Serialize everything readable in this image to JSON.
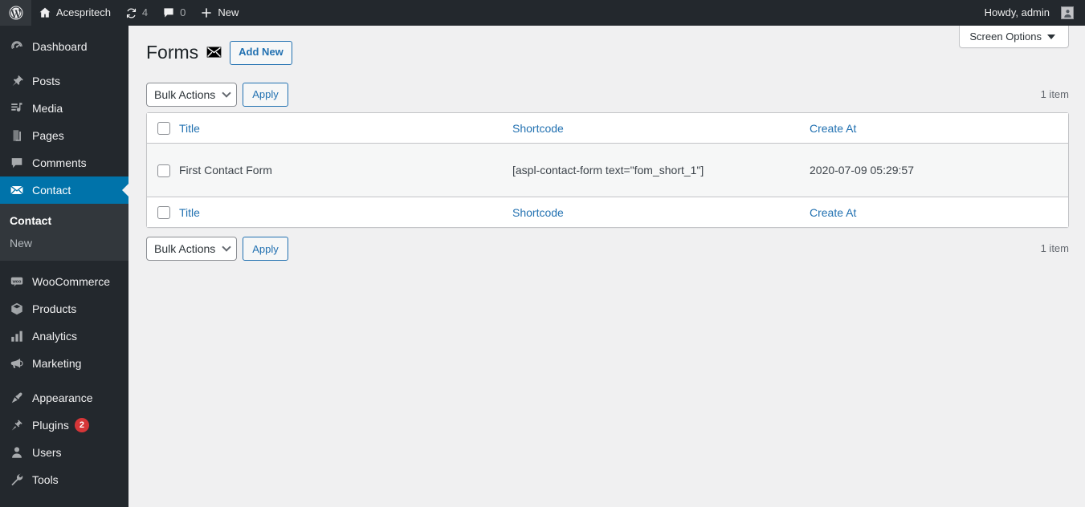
{
  "adminbar": {
    "logo_icon": "wordpress-logo-icon",
    "site_name": "Acespritech",
    "site_icon": "home-icon",
    "updates_icon": "updates-icon",
    "updates_count": "4",
    "comments_icon": "comment-bubble-icon",
    "comments_count": "0",
    "new_icon": "plus-icon",
    "new_label": "New",
    "howdy": "Howdy, admin",
    "avatar_icon": "user-avatar-icon"
  },
  "sidebar": {
    "items": [
      {
        "label": "Dashboard",
        "icon": "dashboard-icon",
        "slug": "dashboard"
      },
      {
        "label": "Posts",
        "icon": "pin-icon",
        "slug": "posts"
      },
      {
        "label": "Media",
        "icon": "media-icon",
        "slug": "media"
      },
      {
        "label": "Pages",
        "icon": "pages-icon",
        "slug": "pages"
      },
      {
        "label": "Comments",
        "icon": "comment-bubble-icon",
        "slug": "comments"
      },
      {
        "label": "Contact",
        "icon": "envelope-icon",
        "slug": "contact",
        "current": true
      },
      {
        "label": "WooCommerce",
        "icon": "woocommerce-icon",
        "slug": "woocommerce"
      },
      {
        "label": "Products",
        "icon": "box-icon",
        "slug": "products"
      },
      {
        "label": "Analytics",
        "icon": "bar-chart-icon",
        "slug": "analytics"
      },
      {
        "label": "Marketing",
        "icon": "megaphone-icon",
        "slug": "marketing"
      },
      {
        "label": "Appearance",
        "icon": "paintbrush-icon",
        "slug": "appearance"
      },
      {
        "label": "Plugins",
        "icon": "plug-icon",
        "slug": "plugins",
        "badge": "2"
      },
      {
        "label": "Users",
        "icon": "user-icon",
        "slug": "users"
      },
      {
        "label": "Tools",
        "icon": "wrench-icon",
        "slug": "tools"
      }
    ],
    "submenu": [
      {
        "label": "Contact",
        "current": true
      },
      {
        "label": "New",
        "current": false
      }
    ]
  },
  "screen_meta": {
    "screen_options_label": "Screen Options"
  },
  "page": {
    "title": "Forms",
    "title_icon": "envelope-icon",
    "add_new_label": "Add New"
  },
  "tablenav": {
    "bulk_actions_label": "Bulk Actions",
    "apply_label": "Apply",
    "displaying_num_top": "1 item",
    "displaying_num_bottom": "1 item"
  },
  "table": {
    "columns": [
      {
        "key": "cb",
        "label": ""
      },
      {
        "key": "title",
        "label": "Title"
      },
      {
        "key": "shortcode",
        "label": "Shortcode"
      },
      {
        "key": "created",
        "label": "Create At"
      }
    ],
    "rows": [
      {
        "title": "First Contact Form",
        "shortcode": "[aspl-contact-form text=\"fom_short_1\"]",
        "created": "2020-07-09 05:29:57"
      }
    ]
  },
  "colors": {
    "adminbar_bg": "#23282d",
    "sidebar_bg": "#23282d",
    "submenu_bg": "#32373c",
    "active_blue": "#0073aa",
    "link_blue": "#2271b1",
    "badge_red": "#d63638",
    "content_bg": "#f0f0f1",
    "row_bg": "#f6f7f7"
  }
}
